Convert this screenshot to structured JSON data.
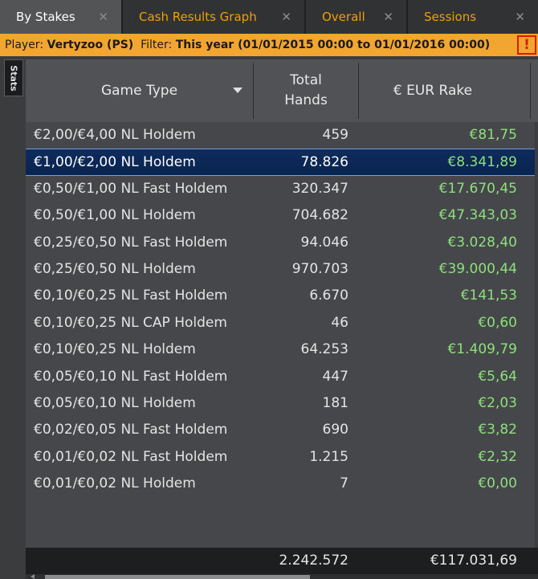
{
  "tabs": [
    {
      "label": "By Stakes",
      "close": "✕"
    },
    {
      "label": "Cash Results Graph",
      "close": "✕"
    },
    {
      "label": "Overall",
      "close": "✕"
    },
    {
      "label": "Sessions",
      "close": "✕"
    }
  ],
  "filter": {
    "player_label": "Player:",
    "player_value": "Vertyzoo (PS)",
    "filter_label": "Filter:",
    "filter_value": "This year (01/01/2015 00:00 to 01/01/2016 00:00)",
    "alert_symbol": "!"
  },
  "side_tab": {
    "label": "Stats"
  },
  "columns": {
    "game_type": "Game Type",
    "total_hands_line1": "Total",
    "total_hands_line2": "Hands",
    "rake": "€ EUR Rake"
  },
  "rows": [
    {
      "game": "€2,00/€4,00 NL Holdem",
      "hands": "459",
      "rake": "€81,75"
    },
    {
      "game": "€1,00/€2,00 NL Holdem",
      "hands": "78.826",
      "rake": "€8.341,89"
    },
    {
      "game": "€0,50/€1,00 NL Fast Holdem",
      "hands": "320.347",
      "rake": "€17.670,45"
    },
    {
      "game": "€0,50/€1,00 NL Holdem",
      "hands": "704.682",
      "rake": "€47.343,03"
    },
    {
      "game": "€0,25/€0,50 NL Fast Holdem",
      "hands": "94.046",
      "rake": "€3.028,40"
    },
    {
      "game": "€0,25/€0,50 NL Holdem",
      "hands": "970.703",
      "rake": "€39.000,44"
    },
    {
      "game": "€0,10/€0,25 NL Fast Holdem",
      "hands": "6.670",
      "rake": "€141,53"
    },
    {
      "game": "€0,10/€0,25 NL CAP Holdem",
      "hands": "46",
      "rake": "€0,60"
    },
    {
      "game": "€0,10/€0,25 NL Holdem",
      "hands": "64.253",
      "rake": "€1.409,79"
    },
    {
      "game": "€0,05/€0,10 NL Fast Holdem",
      "hands": "447",
      "rake": "€5,64"
    },
    {
      "game": "€0,05/€0,10 NL Holdem",
      "hands": "181",
      "rake": "€2,03"
    },
    {
      "game": "€0,02/€0,05 NL Fast Holdem",
      "hands": "690",
      "rake": "€3,82"
    },
    {
      "game": "€0,01/€0,02 NL Fast Holdem",
      "hands": "1.215",
      "rake": "€2,32"
    },
    {
      "game": "€0,01/€0,02 NL Holdem",
      "hands": "7",
      "rake": "€0,00"
    }
  ],
  "totals": {
    "hands": "2.242.572",
    "rake": "€117.031,69"
  },
  "colors": {
    "accent": "#f3a531",
    "rake_positive": "#8ee07c",
    "selected_row": "#0c2b5c",
    "alert": "#d41e00"
  }
}
